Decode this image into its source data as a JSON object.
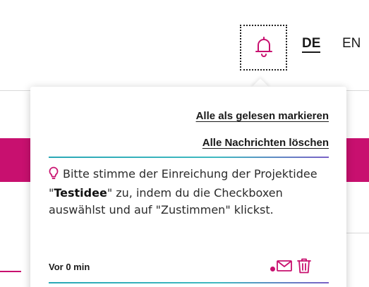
{
  "header": {
    "notifications_icon": "bell-icon",
    "languages": [
      {
        "label": "DE",
        "active": true
      },
      {
        "label": "EN",
        "active": false
      }
    ]
  },
  "notifications": {
    "mark_all_read_label": "Alle als gelesen markieren",
    "delete_all_label": "Alle Nachrichten löschen",
    "items": [
      {
        "icon": "lightbulb-icon",
        "text_before": "Bitte stimme der Einreichung der Projektidee \"",
        "highlight": "Testidee",
        "text_after": "\" zu, indem du die Checkboxen auswählst und auf \"Zustimmen\" klickst.",
        "time": "Vor 0 min",
        "unread": true,
        "actions": [
          "envelope-icon",
          "trash-icon"
        ]
      }
    ]
  },
  "colors": {
    "accent": "#c8106f",
    "separator_start": "#2aa8b6",
    "separator_end": "#7a61c6"
  }
}
